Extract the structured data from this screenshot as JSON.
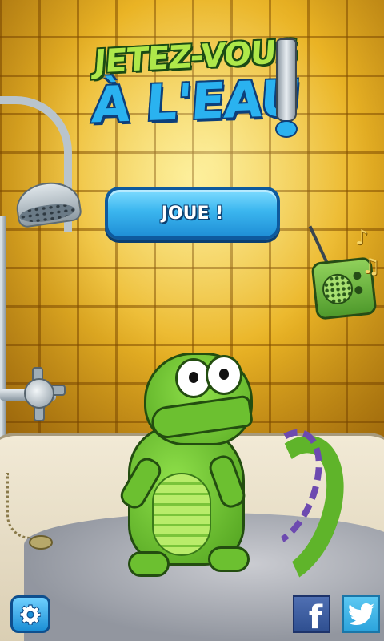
{
  "game": {
    "title_line1": "JETEZ-VOUS",
    "title_line2": "À L'EAU",
    "play_label": "JOUE !"
  },
  "buttons": {
    "settings_icon": "gear-icon",
    "facebook_icon": "facebook-icon",
    "twitter_icon": "twitter-icon"
  },
  "colors": {
    "play_button": "#3bb6ef",
    "title_green": "#aee84a",
    "title_blue": "#2ab2f0",
    "wall_tile": "#e5ac1c",
    "facebook": "#3b5998",
    "twitter": "#2ba3dc"
  }
}
